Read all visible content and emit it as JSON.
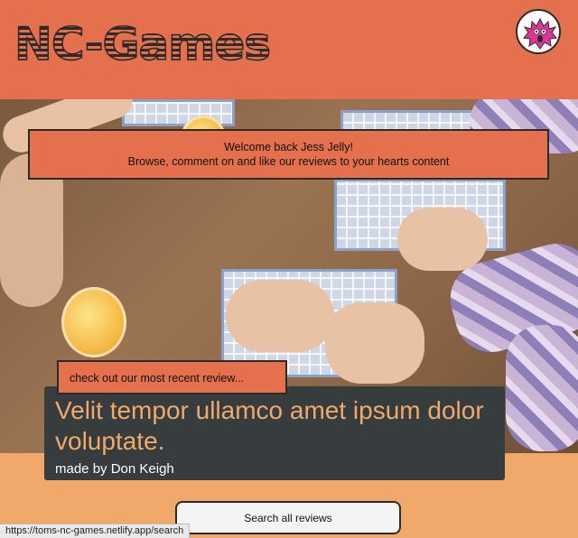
{
  "header": {
    "logo_text": "NC-Games",
    "avatar_icon": "pink-monster-avatar-icon"
  },
  "welcome": {
    "line1": "Welcome back Jess Jelly!",
    "line2": "Browse, comment on and like our reviews to your hearts content"
  },
  "hero": {
    "image": "people-playing-board-game-photo"
  },
  "recent_review": {
    "tab_label": "check out our most recent review...",
    "title": "Velit tempor ullamco amet ipsum dolor voluptate.",
    "author": "made by Don Keigh"
  },
  "search_button": {
    "label": "Search all reviews"
  },
  "status_bar": {
    "url": "https://toms-nc-games.netlify.app/search"
  },
  "colors": {
    "header_bg": "#e5704d",
    "page_bg": "#f0a96a",
    "card_bg": "#373c3e",
    "title_accent": "#f0a96a"
  }
}
